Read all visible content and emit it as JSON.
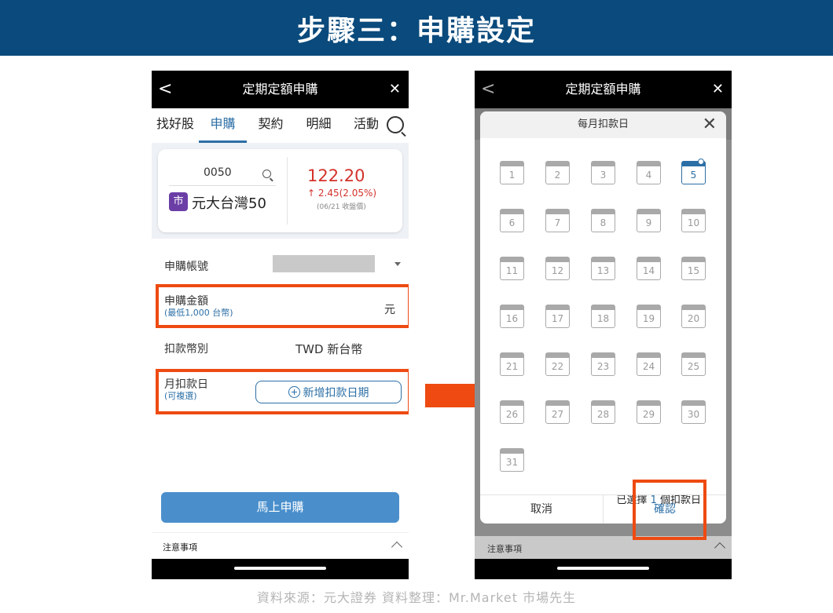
{
  "banner": {
    "title": "步驟三：申購設定"
  },
  "left_phone": {
    "header": {
      "back": "<",
      "title": "定期定額申購",
      "close": "✕"
    },
    "tabs": [
      {
        "label": "找好股",
        "active": false
      },
      {
        "label": "申購",
        "active": true
      },
      {
        "label": "契約",
        "active": false
      },
      {
        "label": "明細",
        "active": false
      },
      {
        "label": "活動",
        "active": false
      }
    ],
    "stock": {
      "code": "0050",
      "market_badge": "市",
      "name": "元大台灣50",
      "price": "122.20",
      "change": "↑ 2.45(2.05%)",
      "date_note": "(06/21 收盤價)"
    },
    "form": {
      "account_label": "申購帳號",
      "amount_label": "申購金額",
      "amount_hint": "(最低1,000 台幣)",
      "amount_unit": "元",
      "currency_label": "扣款幣別",
      "currency_value": "TWD 新台幣",
      "debit_day_label": "月扣款日",
      "debit_day_hint": "(可複選)",
      "add_date_label": "新增扣款日期"
    },
    "submit_label": "馬上申購",
    "notes_label": "注意事項"
  },
  "right_phone": {
    "header": {
      "back": "<",
      "title": "定期定額申購",
      "close": "✕"
    },
    "modal": {
      "title": "每月扣款日",
      "close": "✕",
      "days": [
        "1",
        "2",
        "3",
        "4",
        "5",
        "6",
        "7",
        "8",
        "9",
        "10",
        "11",
        "12",
        "13",
        "14",
        "15",
        "16",
        "17",
        "18",
        "19",
        "20",
        "21",
        "22",
        "23",
        "24",
        "25",
        "26",
        "27",
        "28",
        "29",
        "30",
        "31"
      ],
      "selected_day": "5",
      "summary_prefix": "已選擇",
      "summary_count": "1",
      "summary_suffix": "個扣款日",
      "cancel_label": "取消",
      "confirm_label": "確認"
    },
    "notes_label": "注意事項"
  },
  "colors": {
    "highlight": "#ee4a12",
    "accent": "#2c6fa6",
    "banner": "#0a4a7c",
    "price": "#d3322a"
  },
  "credit": "資料來源：元大證券  資料整理：Mr.Market 市場先生"
}
